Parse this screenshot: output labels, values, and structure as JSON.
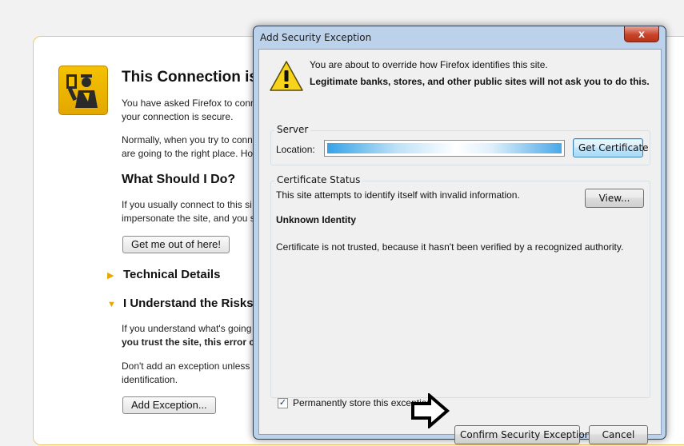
{
  "error_page": {
    "title": "This Connection is",
    "para1_line1": "You have asked Firefox to conn",
    "para1_line2": "your connection is secure.",
    "para2_line1": "Normally, when you try to conn",
    "para2_line2": "are going to the right place. Ho",
    "heading": "What Should I Do?",
    "para3_line1": "If you usually connect to this si",
    "para3_line2": "impersonate the site, and you s",
    "get_out_button": "Get me out of here!",
    "technical_details": "Technical Details",
    "understand_risks": "I Understand the Risks",
    "para4_line1": "If you understand what's going",
    "para4_line2": "you trust the site, this error co",
    "para5_line1": "Don't add an exception unless y",
    "para5_line2": "identification.",
    "add_exception_button": "Add Exception..."
  },
  "dialog": {
    "title": "Add Security Exception",
    "close_symbol": "x",
    "warning_line1": "You are about to override how Firefox identifies this site.",
    "warning_line2": "Legitimate banks, stores, and other public sites will not ask you to do this.",
    "server_group_label": "Server",
    "location_label": "Location:",
    "location_value": "",
    "get_certificate_button": "Get Certificate",
    "status_group_label": "Certificate Status",
    "status_line": "This site attempts to identify itself with invalid information.",
    "view_button": "View...",
    "unknown_identity": "Unknown Identity",
    "not_trusted_line": "Certificate is not trusted, because it hasn't been verified by a recognized authority.",
    "permanent_label": "Permanently store this exception",
    "permanent_checked": true,
    "confirm_button": "Confirm Security Exception",
    "cancel_button": "Cancel"
  },
  "colors": {
    "accent_blue": "#3c7fb1",
    "warning_yellow": "#f5c200",
    "close_red": "#c7432b"
  },
  "icons": {
    "police": "police-officer-icon",
    "warning": "warning-triangle-icon",
    "pointer": "right-arrow-icon"
  }
}
